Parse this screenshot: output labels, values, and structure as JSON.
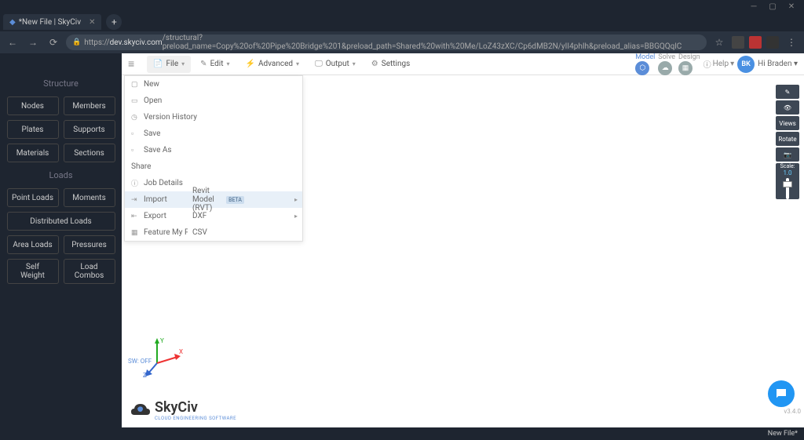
{
  "browser": {
    "tab_title": "*New File | SkyCiv",
    "url_prefix": "https://",
    "url_domain": "dev.skyciv.com",
    "url_path": "/structural?preload_name=Copy%20of%20Pipe%20Bridge%201&preload_path=Shared%20with%20Me/LoZ43zXC/Cp6dMB2N/yII4phIh&preload_alias=BBGQQqlC"
  },
  "toolbar": {
    "file": "File",
    "edit": "Edit",
    "advanced": "Advanced",
    "output": "Output",
    "settings": "Settings",
    "help": "Help"
  },
  "status": {
    "model": "Model",
    "solve": "Solve",
    "design": "Design"
  },
  "user": {
    "initials": "BK",
    "greeting": "Hi Braden"
  },
  "sidebar": {
    "structure": "Structure",
    "loads": "Loads",
    "buttons": {
      "nodes": "Nodes",
      "members": "Members",
      "plates": "Plates",
      "supports": "Supports",
      "materials": "Materials",
      "sections": "Sections",
      "point_loads": "Point Loads",
      "moments": "Moments",
      "distributed_loads": "Distributed Loads",
      "area_loads": "Area Loads",
      "pressures": "Pressures",
      "self_weight": "Self\nWeight",
      "load_combos": "Load\nCombos"
    }
  },
  "filemenu": {
    "new": "New",
    "open": "Open",
    "version_history": "Version History",
    "save": "Save",
    "save_as": "Save As",
    "share": "Share",
    "job_details": "Job Details",
    "import": "Import",
    "export": "Export",
    "feature_project": "Feature My Project"
  },
  "import_submenu": {
    "revit": "Revit Model (RVT)",
    "revit_badge": "BETA",
    "dxf": "DXF",
    "csv": "CSV"
  },
  "canvas": {
    "sw_label": "SW: OFF",
    "axes": {
      "x": "X",
      "y": "Y",
      "z": "Z"
    }
  },
  "logo": {
    "name": "SkyCiv",
    "sub": "CLOUD ENGINEERING SOFTWARE"
  },
  "righttools": {
    "views": "Views",
    "rotate": "Rotate",
    "scale_label": "Scale:",
    "scale_value": "1.0"
  },
  "footer": {
    "version": "v3.4.0",
    "filename": "New File*"
  }
}
